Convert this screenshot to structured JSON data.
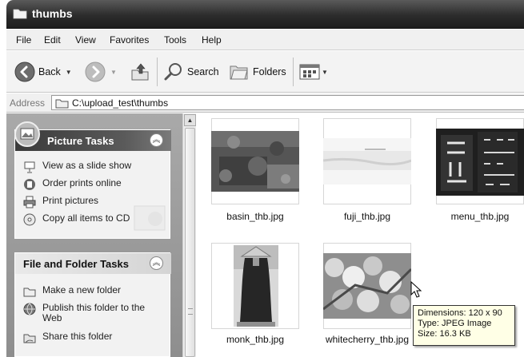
{
  "window": {
    "title": "thumbs"
  },
  "menu": {
    "items": [
      "File",
      "Edit",
      "View",
      "Favorites",
      "Tools",
      "Help"
    ]
  },
  "toolbar": {
    "back_label": "Back",
    "search_label": "Search",
    "folders_label": "Folders"
  },
  "address": {
    "label": "Address",
    "path": "C:\\upload_test\\thumbs"
  },
  "sidebar": {
    "picture_tasks": {
      "title": "Picture Tasks",
      "items": [
        "View as a slide show",
        "Order prints online",
        "Print pictures",
        "Copy all items to CD"
      ]
    },
    "file_folder_tasks": {
      "title": "File and Folder Tasks",
      "items": [
        "Make a new folder",
        "Publish this folder to the Web",
        "Share this folder"
      ]
    }
  },
  "files": [
    {
      "name": "basin_thb.jpg"
    },
    {
      "name": "fuji_thb.jpg"
    },
    {
      "name": "menu_thb.jpg"
    },
    {
      "name": "monk_thb.jpg"
    },
    {
      "name": "whitecherry_thb.jpg"
    }
  ],
  "tooltip": {
    "dimensions": "Dimensions: 120 x 90",
    "type": "Type: JPEG Image",
    "size": "Size: 16.3 KB"
  },
  "icons": [
    "folder-icon",
    "back-icon",
    "forward-icon",
    "up-folder-icon",
    "search-icon",
    "folders-icon",
    "views-icon",
    "collapse-icon",
    "cursor-icon"
  ]
}
